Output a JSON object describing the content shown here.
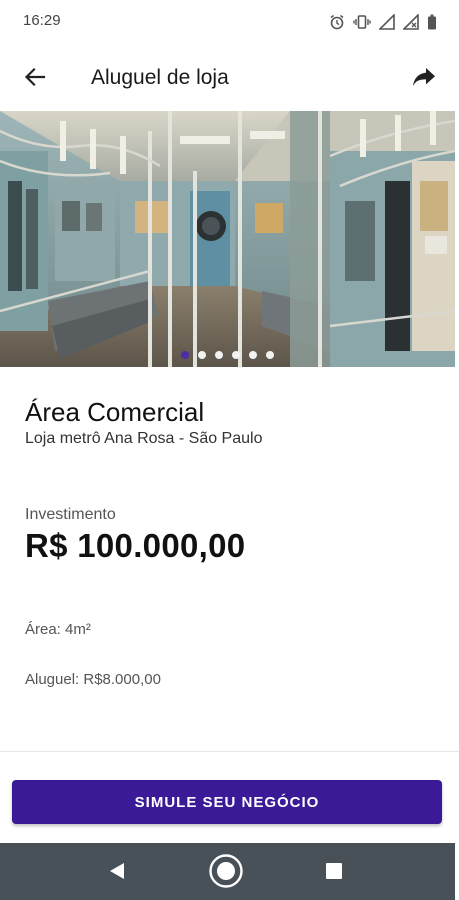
{
  "status": {
    "time": "16:29",
    "icons": [
      "alarm-icon",
      "vibrate-icon",
      "signal-icon",
      "signal-x-icon",
      "battery-icon"
    ]
  },
  "appbar": {
    "title": "Aluguel de loja",
    "back_icon": "arrow-left-icon",
    "share_icon": "share-icon"
  },
  "gallery": {
    "image": "subway-car-interior",
    "dot_count": 6,
    "active_index": 0
  },
  "listing": {
    "title": "Área Comercial",
    "subtitle": "Loja metrô Ana Rosa - São Paulo",
    "investment_label": "Investimento",
    "investment_value": "R$ 100.000,00",
    "area": "Área: 4m²",
    "rent": "Aluguel: R$8.000,00"
  },
  "cta": {
    "label": "SIMULE SEU NEGÓCIO"
  },
  "navbar": {
    "icons": [
      "nav-back-icon",
      "nav-home-icon",
      "nav-recent-icon"
    ]
  },
  "colors": {
    "accent": "#3a1a96",
    "dot_active": "#4d2ca6",
    "navbar": "#485058"
  }
}
